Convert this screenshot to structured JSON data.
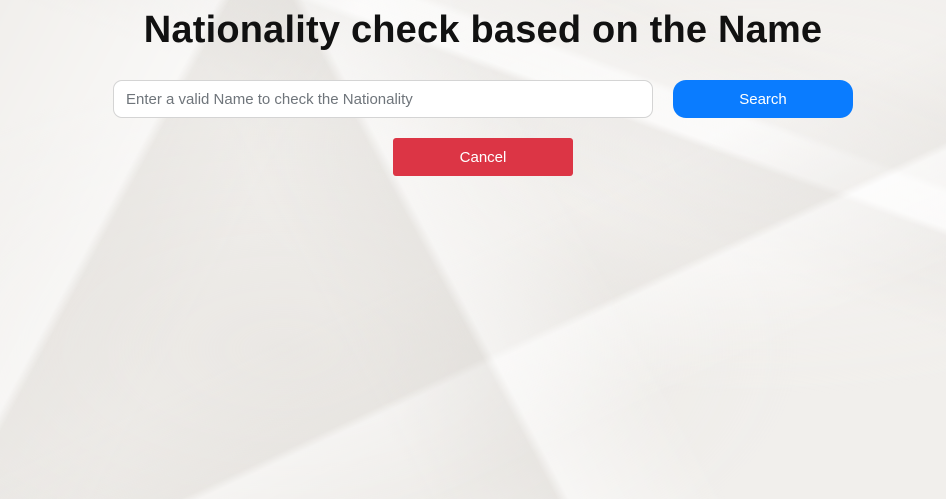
{
  "page": {
    "title": "Nationality check based on the Name"
  },
  "search": {
    "placeholder": "Enter a valid Name to check the Nationality",
    "value": "",
    "button_label": "Search"
  },
  "actions": {
    "cancel_label": "Cancel"
  },
  "colors": {
    "search_button": "#0a7cff",
    "cancel_button": "#dc3545",
    "background": "#f1efec",
    "title_text": "#111111"
  }
}
